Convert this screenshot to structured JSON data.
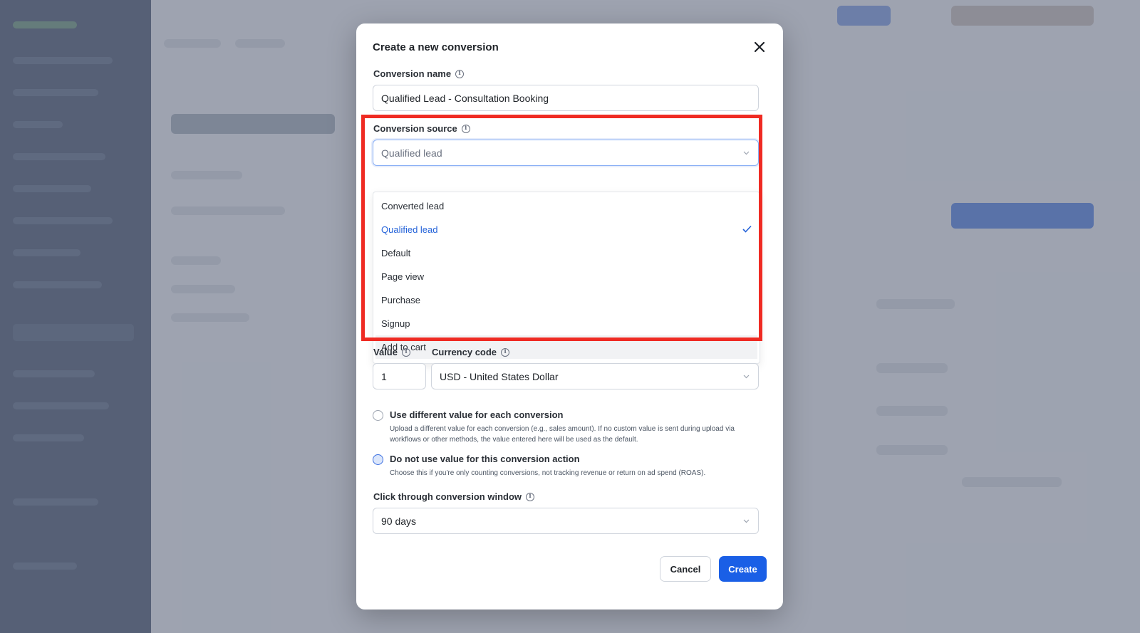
{
  "modal": {
    "title": "Create a new conversion",
    "conversion_name": {
      "label": "Conversion name",
      "value": "Qualified Lead - Consultation Booking"
    },
    "conversion_source": {
      "label": "Conversion source",
      "selected": "Qualified lead",
      "options": [
        {
          "label": "Converted lead",
          "selected": false
        },
        {
          "label": "Qualified lead",
          "selected": true
        },
        {
          "label": "Default",
          "selected": false
        },
        {
          "label": "Page view",
          "selected": false
        },
        {
          "label": "Purchase",
          "selected": false
        },
        {
          "label": "Signup",
          "selected": false
        },
        {
          "label": "Add to cart",
          "selected": false
        }
      ]
    },
    "value": {
      "label": "Value",
      "value": "1"
    },
    "currency": {
      "label": "Currency code",
      "value": "USD - United States Dollar"
    },
    "value_options": [
      {
        "title": "Use different value for each conversion",
        "description": "Upload a different value for each conversion (e.g., sales amount). If no custom value is sent during upload via workflows or other methods, the value entered here will be used as the default.",
        "checked": false
      },
      {
        "title": "Do not use value for this conversion action",
        "description": "Choose this if you're only counting conversions, not tracking revenue or return on ad spend (ROAS).",
        "checked": true
      }
    ],
    "click_window": {
      "label": "Click through conversion window",
      "value": "90 days"
    },
    "cancel_label": "Cancel",
    "create_label": "Create"
  },
  "colors": {
    "primary": "#1a5fe6",
    "selected_option": "#2563d9",
    "highlight_border": "#ef2b23"
  },
  "icons": [
    "close-icon",
    "info-icon",
    "chevron-down-icon",
    "checkmark-icon"
  ]
}
